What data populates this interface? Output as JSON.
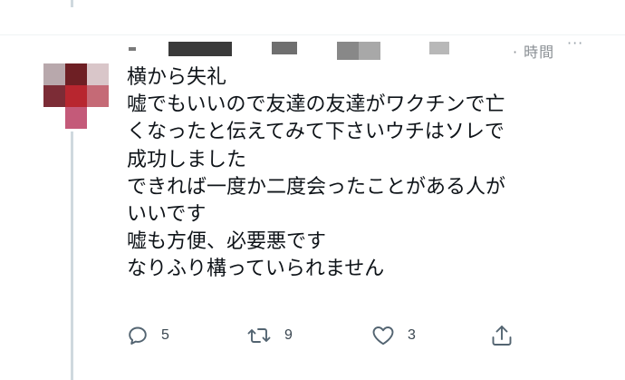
{
  "tweet": {
    "lines": [
      "横から失礼",
      "嘘でもいいので友達の友達がワクチンで亡",
      "くなったと伝えてみて下さいウチはソレで",
      "成功しました",
      "できれば一度か二度会ったことがある人が",
      "いいです",
      "嘘も方便、必要悪です",
      "なりふり構っていられません"
    ],
    "time_stub": "·  時間",
    "more_icon": "···"
  },
  "actions": {
    "reply": {
      "icon": "reply-icon",
      "count": "5"
    },
    "retweet": {
      "icon": "retweet-icon",
      "count": "9"
    },
    "like": {
      "icon": "heart-icon",
      "count": "3"
    },
    "share": {
      "icon": "share-icon"
    }
  },
  "colors": {
    "text": "#0f1419",
    "icon": "#536471",
    "thread_line": "#cfd9de"
  }
}
